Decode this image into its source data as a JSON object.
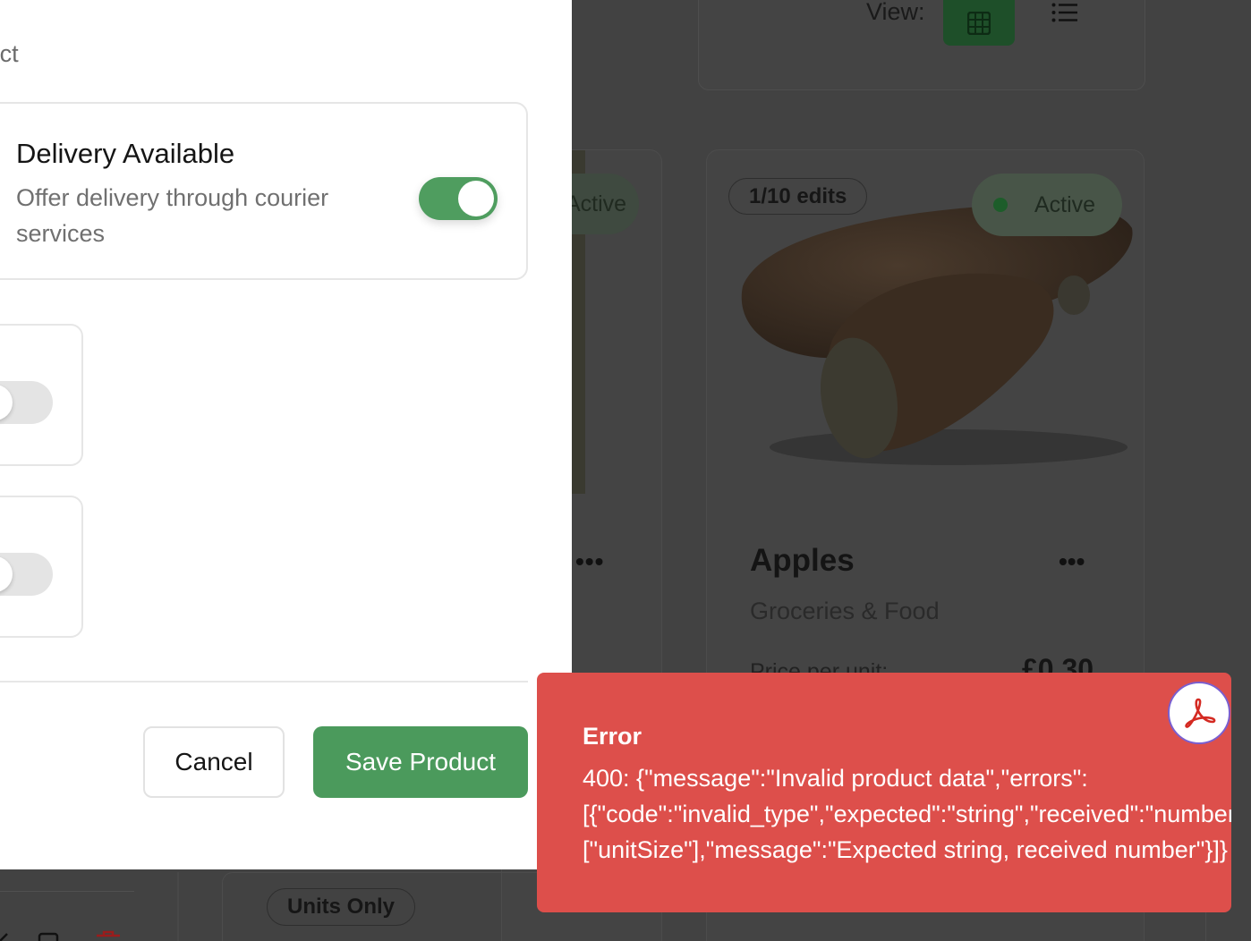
{
  "background": {
    "view_label": "View:",
    "view_grid_icon": "grid-icon",
    "view_list_icon": "list-icon",
    "left_card": {
      "status": "Active"
    },
    "product_card": {
      "edits": "1/10 edits",
      "status": "Active",
      "name": "Apples",
      "category": "Groceries & Food",
      "price_label": "Price per unit:",
      "price_value": "£0.30"
    },
    "units_badge": "Units Only"
  },
  "modal": {
    "title": "Add Product",
    "delivery": {
      "title": "Delivery Available",
      "description": "Offer delivery through courier services",
      "enabled": true
    },
    "option_toggles": [
      {
        "enabled": false
      },
      {
        "enabled": false
      }
    ],
    "cancel_label": "Cancel",
    "save_label": "Save Product"
  },
  "toast": {
    "title": "Error",
    "lines": [
      "400: {\"message\":\"Invalid product data\",\"errors\":",
      "[{\"code\":\"invalid_type\",\"expected\":\"string\",\"received\":\"number\",\"path\":",
      "[\"unitSize\"],\"message\":\"Expected string, received number\"}]}"
    ],
    "badge_icon": "adobe-acrobat-icon"
  },
  "colors": {
    "accent_green": "#4b9a5c",
    "toast_red": "#dd4f4b"
  }
}
